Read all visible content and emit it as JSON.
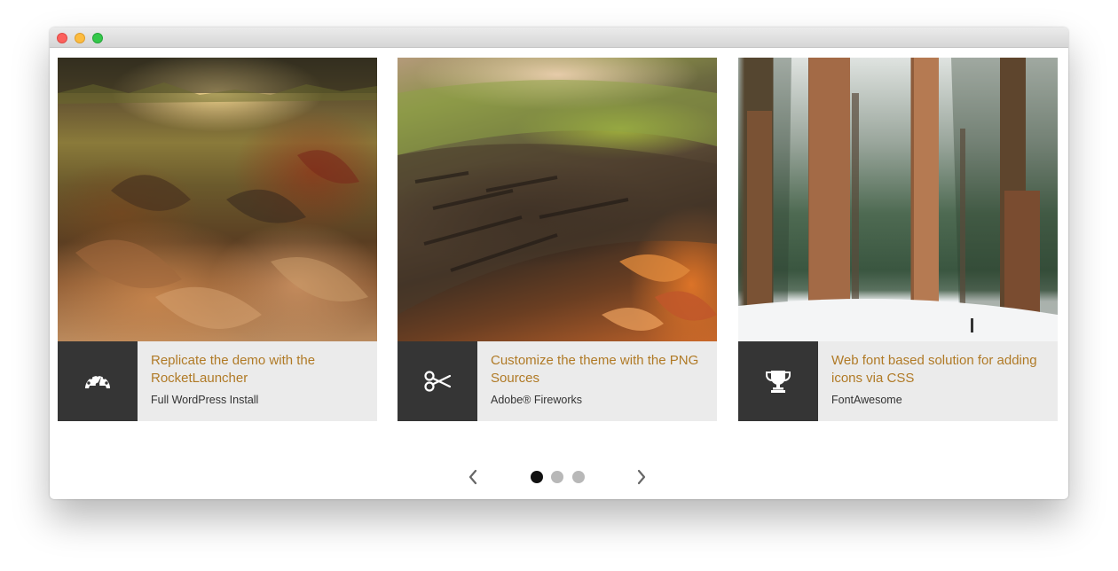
{
  "window": {
    "controls": [
      "close",
      "minimize",
      "maximize"
    ]
  },
  "cards": [
    {
      "image": "autumn-leaves-forest-photo",
      "icon": "speedometer-icon",
      "title": "Replicate the demo with the RocketLauncher",
      "subtitle": "Full WordPress Install"
    },
    {
      "image": "mossy-log-photo",
      "icon": "scissors-icon",
      "title": "Customize the theme with the PNG Sources",
      "subtitle": "Adobe® Fireworks"
    },
    {
      "image": "snowy-redwood-forest-photo",
      "icon": "trophy-icon",
      "title": "Web font based solution for adding icons via CSS",
      "subtitle": "FontAwesome"
    }
  ],
  "pager": {
    "prev_icon": "chevron-left-icon",
    "next_icon": "chevron-right-icon",
    "dots": 3,
    "active_dot": 1
  },
  "colors": {
    "title_color": "#b07a26",
    "icon_box": "#353535",
    "card_bar": "#ebebeb",
    "dot_active": "#111111",
    "dot_inactive": "#b8b8b8"
  }
}
